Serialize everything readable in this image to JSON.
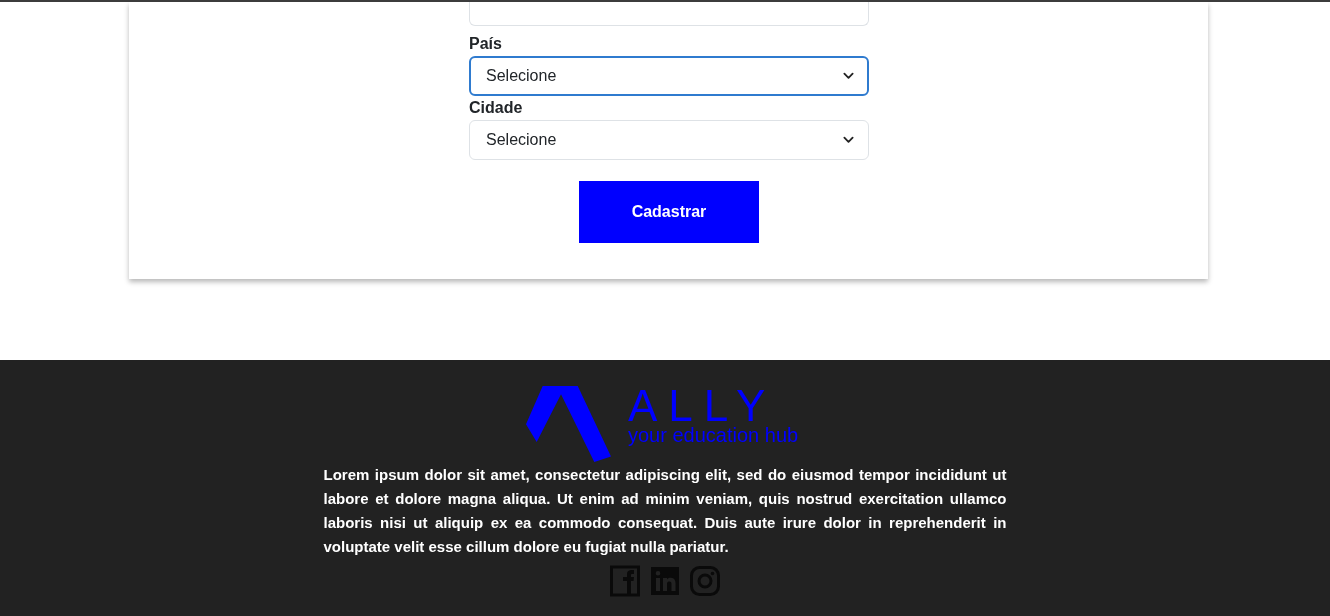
{
  "form": {
    "fields": [
      {
        "kind": "input"
      },
      {
        "kind": "select",
        "label": "País",
        "value": "Selecione",
        "focused": true
      },
      {
        "kind": "select",
        "label": "Cidade",
        "value": "Selecione",
        "focused": false
      }
    ],
    "submit_button": {
      "label": "Cadastrar"
    }
  },
  "footer": {
    "logo": {
      "name": "ALLY",
      "tagline": "your education hub"
    },
    "text": "Lorem ipsum dolor sit amet, consectetur adipiscing elit, sed do eiusmod tempor incididunt ut labore et dolore magna aliqua. Ut enim ad minim veniam, quis nostrud exercitation ullamco laboris nisi ut aliquip ex ea commodo consequat. Duis aute irure dolor in reprehenderit in voluptate velit esse cillum dolore eu fugiat nulla pariatur.",
    "social_links": [
      {
        "kind": "facebook"
      },
      {
        "kind": "linkedin"
      },
      {
        "kind": "instagram"
      }
    ]
  }
}
